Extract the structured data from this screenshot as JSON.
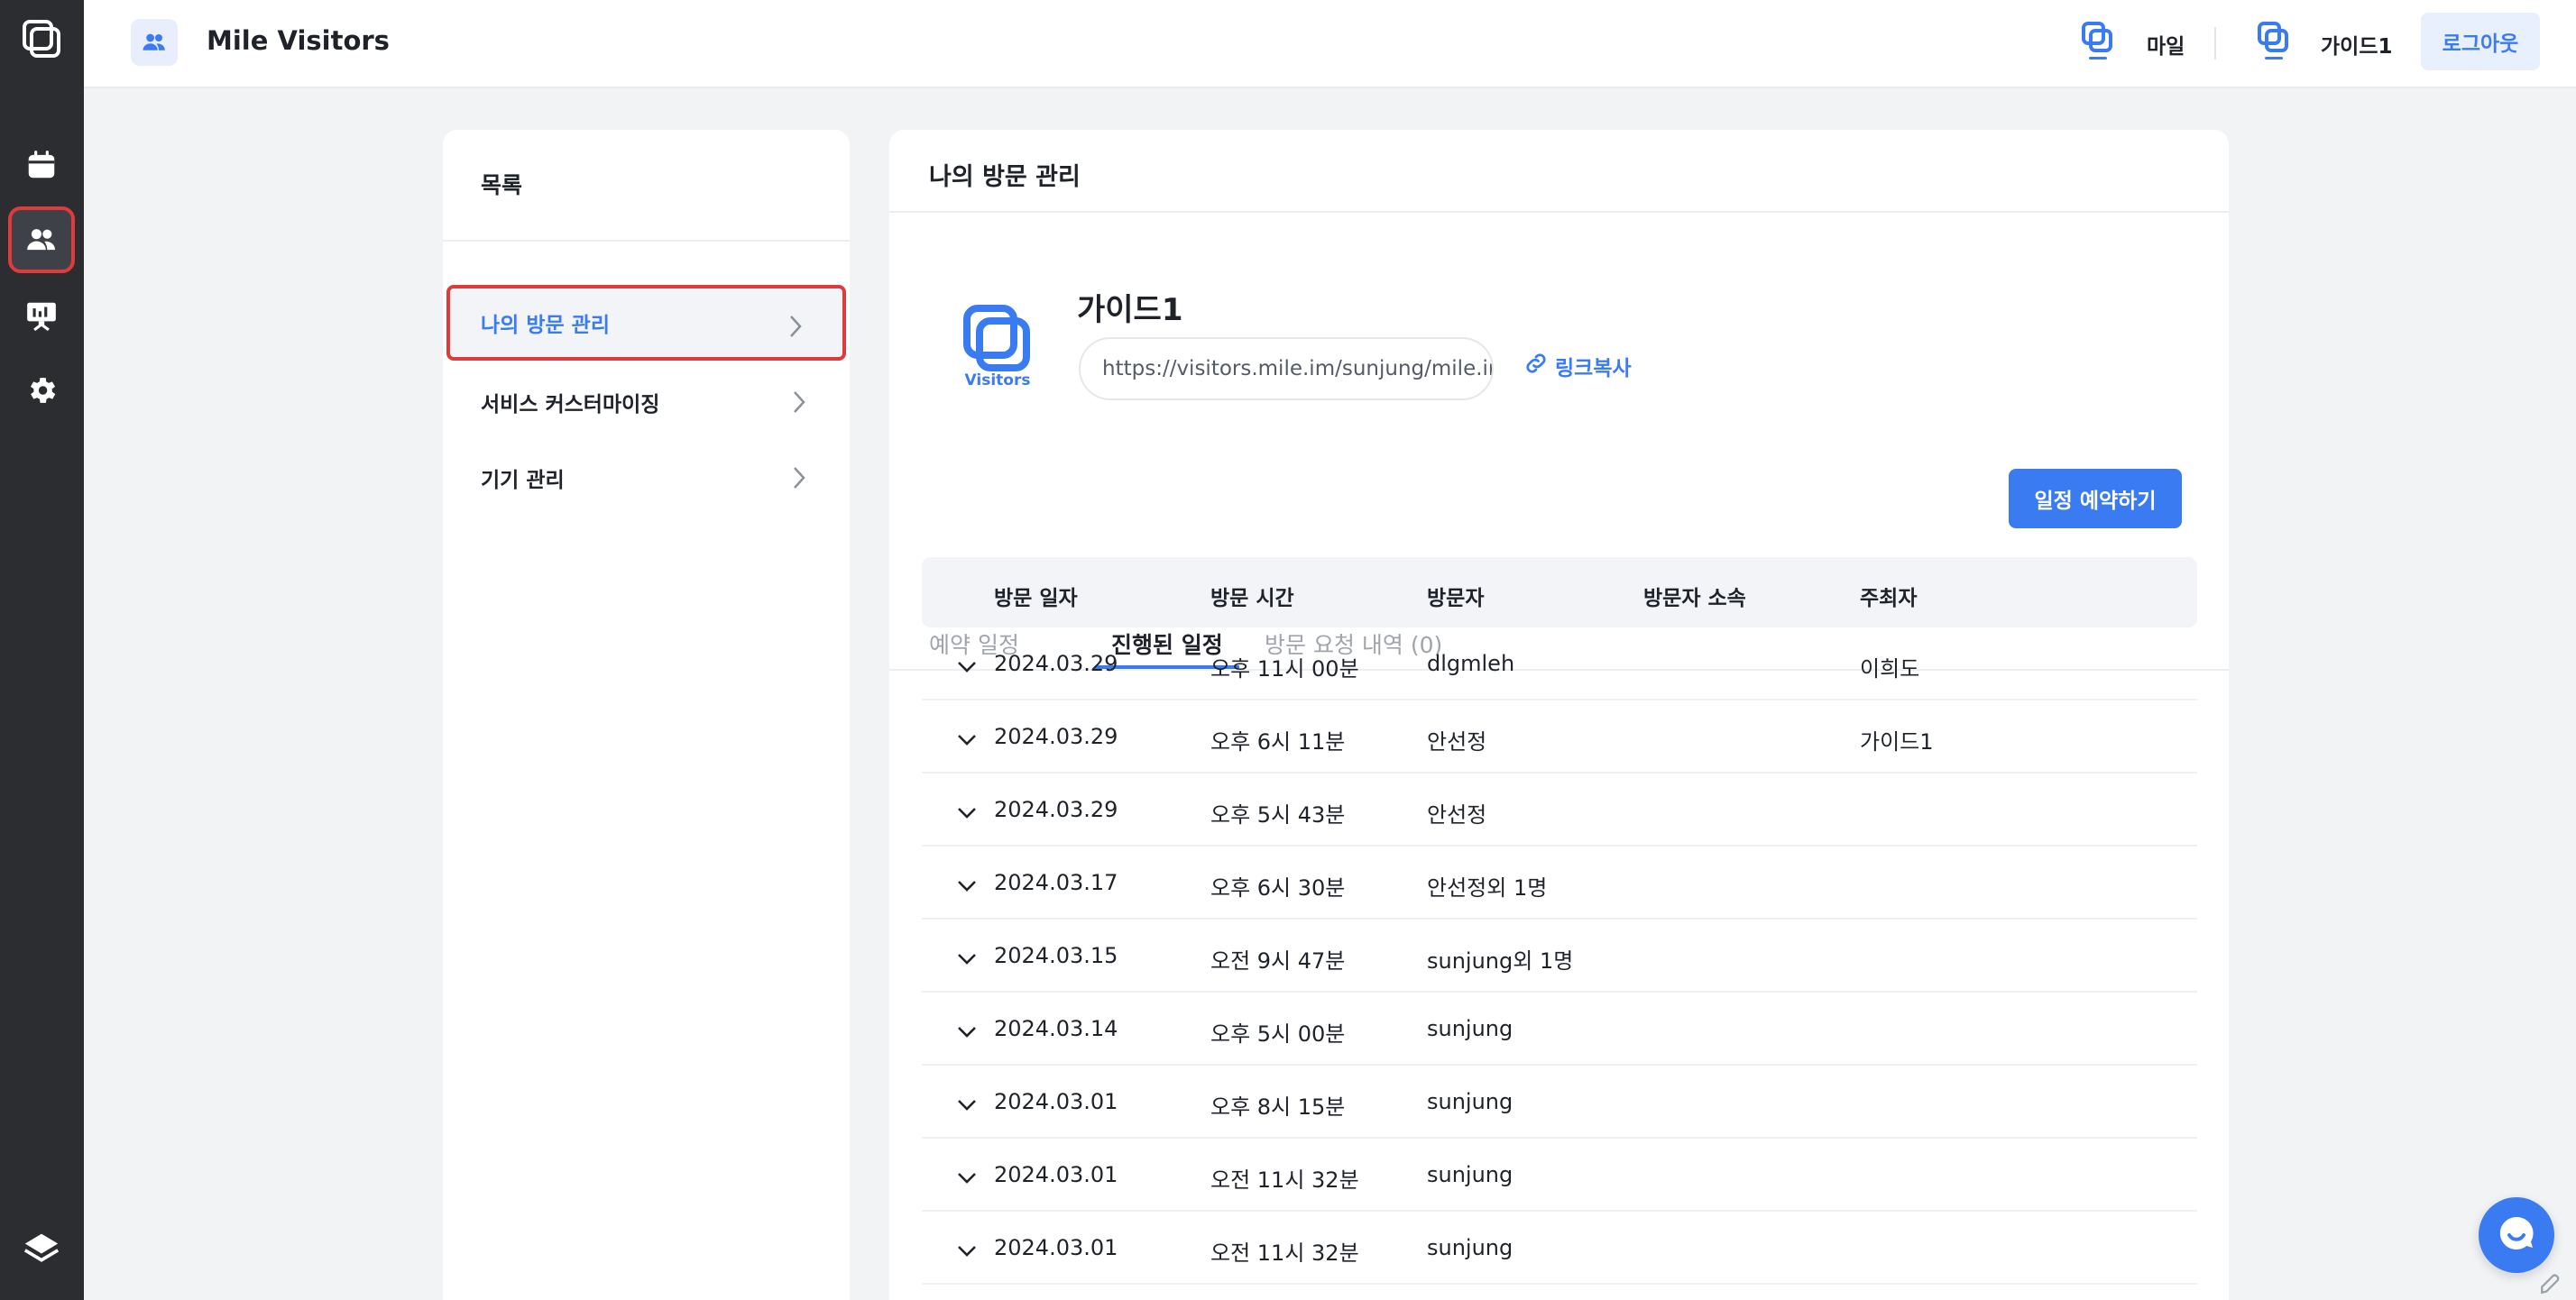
{
  "app": {
    "title": "Mile Visitors",
    "icon": "people-icon"
  },
  "rail": {
    "items": [
      {
        "icon": "logo-icon"
      },
      {
        "icon": "calendar-icon"
      },
      {
        "icon": "people-icon",
        "active": true
      },
      {
        "icon": "presentation-icon"
      },
      {
        "icon": "gear-icon"
      },
      {
        "icon": "layers-icon"
      }
    ]
  },
  "topbar": {
    "workspace": {
      "logo": "visitors-logo",
      "name": "마일"
    },
    "user": {
      "logo": "visitors-logo",
      "name": "가이드1"
    },
    "logout_label": "로그아웃"
  },
  "menu": {
    "title": "목록",
    "items": [
      {
        "label": "나의 방문 관리",
        "active": true
      },
      {
        "label": "서비스 커스터마이징"
      },
      {
        "label": "기기 관리"
      }
    ]
  },
  "main": {
    "title": "나의 방문 관리",
    "profile": {
      "logo_text": "Visitors",
      "name": "가이드1",
      "link": "https://visitors.mile.im/sunjung/mile.im",
      "copy_label": "링크복사"
    },
    "tabs": [
      {
        "label": "예약 일정"
      },
      {
        "label": "진행된 일정",
        "active": true
      },
      {
        "label": "방문 요청 내역 (0)"
      }
    ],
    "reserve_label": "일정 예약하기",
    "table": {
      "columns": [
        "방문 일자",
        "방문 시간",
        "방문자",
        "방문자 소속",
        "주최자"
      ],
      "rows": [
        {
          "date": "2024.03.29",
          "time": "오후 11시 00분",
          "visitor": "dlgmleh",
          "affiliation": "",
          "host": "이희도"
        },
        {
          "date": "2024.03.29",
          "time": "오후 6시 11분",
          "visitor": "안선정",
          "affiliation": "",
          "host": "가이드1"
        },
        {
          "date": "2024.03.29",
          "time": "오후 5시 43분",
          "visitor": "안선정",
          "affiliation": "",
          "host": ""
        },
        {
          "date": "2024.03.17",
          "time": "오후 6시 30분",
          "visitor": "안선정외 1명",
          "affiliation": "",
          "host": ""
        },
        {
          "date": "2024.03.15",
          "time": "오전 9시 47분",
          "visitor": "sunjung외 1명",
          "affiliation": "",
          "host": ""
        },
        {
          "date": "2024.03.14",
          "time": "오후 5시 00분",
          "visitor": "sunjung",
          "affiliation": "",
          "host": ""
        },
        {
          "date": "2024.03.01",
          "time": "오후 8시 15분",
          "visitor": "sunjung",
          "affiliation": "",
          "host": ""
        },
        {
          "date": "2024.03.01",
          "time": "오전 11시 32분",
          "visitor": "sunjung",
          "affiliation": "",
          "host": ""
        },
        {
          "date": "2024.03.01",
          "time": "오전 11시 32분",
          "visitor": "sunjung",
          "affiliation": "",
          "host": ""
        }
      ]
    }
  },
  "colors": {
    "accent": "#3b7bf2",
    "rail_bg": "#2b2d31",
    "highlight": "#e03a3a"
  }
}
